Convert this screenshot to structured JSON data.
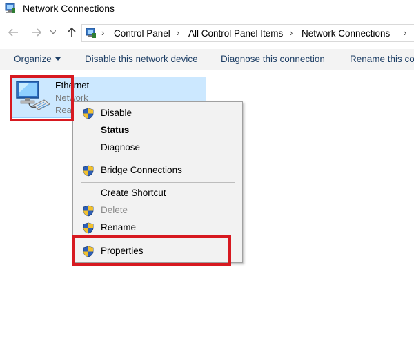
{
  "window": {
    "title": "Network Connections"
  },
  "address": {
    "crumbs": [
      "Control Panel",
      "All Control Panel Items",
      "Network Connections"
    ]
  },
  "toolbar": {
    "organize": "Organize",
    "disable": "Disable this network device",
    "diagnose": "Diagnose this connection",
    "rename": "Rename this co"
  },
  "connection": {
    "name": "Ethernet",
    "network": "Network",
    "status": "Rea"
  },
  "menu": {
    "items": [
      {
        "label": "Disable",
        "shield": true
      },
      {
        "label": "Status",
        "bold": true
      },
      {
        "label": "Diagnose"
      },
      {
        "label": "Bridge Connections",
        "shield": true
      },
      {
        "label": "Create Shortcut"
      },
      {
        "label": "Delete",
        "shield": true,
        "disabled": true
      },
      {
        "label": "Rename",
        "shield": true
      },
      {
        "label": "Properties",
        "shield": true
      }
    ]
  },
  "colors": {
    "highlight": "#cce8ff",
    "annotation": "#d71920",
    "command_text": "#1e3f66"
  }
}
